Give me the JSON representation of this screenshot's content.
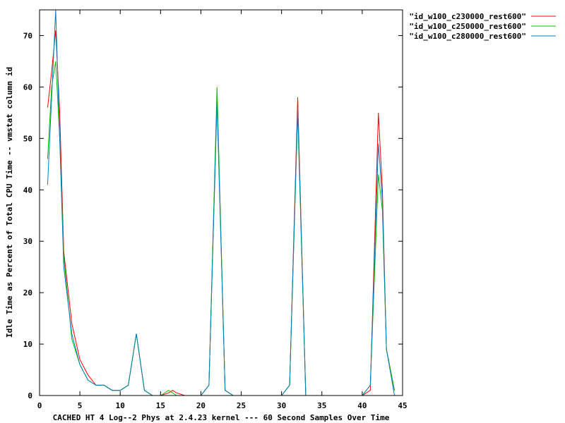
{
  "chart_data": {
    "type": "line",
    "xlabel": "CACHED HT 4 Log--2 Phys at 2.4.23 kernel --- 60 Second Samples Over Time",
    "ylabel": "Idle Time as Percent of Total CPU Time -- vmstat column id",
    "xlim": [
      0,
      45
    ],
    "ylim": [
      0,
      75
    ],
    "xticks": [
      0,
      5,
      10,
      15,
      20,
      25,
      30,
      35,
      40,
      45
    ],
    "yticks": [
      0,
      10,
      20,
      30,
      40,
      50,
      60,
      70
    ],
    "grid": false,
    "legend_position": "top-right",
    "series": [
      {
        "name": "\"id_w100_c230000_rest600\"",
        "color": "#ff0000",
        "points": [
          [
            1,
            56
          ],
          [
            1.5,
            63
          ],
          [
            2,
            71
          ],
          [
            2.5,
            55
          ],
          [
            3,
            28
          ],
          [
            4,
            14
          ],
          [
            5,
            7
          ],
          [
            6,
            4
          ],
          [
            7,
            2
          ],
          [
            8,
            2
          ],
          [
            9,
            1
          ],
          [
            10,
            1
          ],
          [
            11,
            2
          ],
          [
            12,
            12
          ],
          [
            13,
            1
          ],
          [
            14,
            0
          ],
          [
            15,
            0
          ],
          [
            16,
            0.5
          ],
          [
            16.5,
            1
          ],
          [
            17,
            0.5
          ],
          [
            18,
            0
          ],
          [
            19,
            0
          ],
          [
            20,
            0
          ],
          [
            21,
            2
          ],
          [
            22,
            58
          ],
          [
            23,
            1
          ],
          [
            24,
            0
          ],
          [
            25,
            0
          ],
          [
            26,
            0
          ],
          [
            27,
            0
          ],
          [
            28,
            0
          ],
          [
            29,
            0
          ],
          [
            30,
            0
          ],
          [
            31,
            2
          ],
          [
            32,
            58
          ],
          [
            33,
            0
          ],
          [
            34,
            0
          ],
          [
            35,
            0
          ],
          [
            36,
            0
          ],
          [
            37,
            0
          ],
          [
            38,
            0
          ],
          [
            39,
            0
          ],
          [
            40,
            0
          ],
          [
            41,
            1
          ],
          [
            42,
            55
          ],
          [
            42.5,
            40
          ],
          [
            43,
            9
          ],
          [
            44,
            1
          ]
        ]
      },
      {
        "name": "\"id_w100_c250000_rest600\"",
        "color": "#00c000",
        "points": [
          [
            1,
            46
          ],
          [
            1.5,
            60
          ],
          [
            2,
            65
          ],
          [
            2.5,
            50
          ],
          [
            3,
            27
          ],
          [
            4,
            11
          ],
          [
            5,
            6
          ],
          [
            6,
            3
          ],
          [
            7,
            2
          ],
          [
            8,
            2
          ],
          [
            9,
            1
          ],
          [
            10,
            1
          ],
          [
            11,
            2
          ],
          [
            12,
            12
          ],
          [
            13,
            1
          ],
          [
            14,
            0
          ],
          [
            15,
            0
          ],
          [
            16,
            1
          ],
          [
            17,
            0
          ],
          [
            18,
            0
          ],
          [
            19,
            0
          ],
          [
            20,
            0
          ],
          [
            21,
            2
          ],
          [
            22,
            60
          ],
          [
            23,
            1
          ],
          [
            24,
            0
          ],
          [
            25,
            0
          ],
          [
            26,
            0
          ],
          [
            27,
            0
          ],
          [
            28,
            0
          ],
          [
            29,
            0
          ],
          [
            30,
            0
          ],
          [
            31,
            2
          ],
          [
            32,
            55
          ],
          [
            33,
            0
          ],
          [
            34,
            0
          ],
          [
            35,
            0
          ],
          [
            36,
            0
          ],
          [
            37,
            0
          ],
          [
            38,
            0
          ],
          [
            39,
            0
          ],
          [
            40,
            0
          ],
          [
            41,
            2
          ],
          [
            42,
            43
          ],
          [
            42.5,
            36
          ],
          [
            43,
            9
          ],
          [
            44,
            1
          ]
        ]
      },
      {
        "name": "\"id_w100_c280000_rest600\"",
        "color": "#0080c0",
        "points": [
          [
            1,
            41
          ],
          [
            1.5,
            58
          ],
          [
            2,
            75
          ],
          [
            2.5,
            50
          ],
          [
            3,
            25
          ],
          [
            4,
            12
          ],
          [
            5,
            6
          ],
          [
            6,
            3
          ],
          [
            7,
            2
          ],
          [
            8,
            2
          ],
          [
            9,
            1
          ],
          [
            10,
            1
          ],
          [
            11,
            2
          ],
          [
            12,
            12
          ],
          [
            13,
            1
          ],
          [
            14,
            0
          ],
          [
            15,
            0
          ],
          [
            16,
            0
          ],
          [
            17,
            0
          ],
          [
            18,
            0
          ],
          [
            19,
            0
          ],
          [
            20,
            0
          ],
          [
            21,
            2
          ],
          [
            22,
            57
          ],
          [
            23,
            1
          ],
          [
            24,
            0
          ],
          [
            25,
            0
          ],
          [
            26,
            0
          ],
          [
            27,
            0
          ],
          [
            28,
            0
          ],
          [
            29,
            0
          ],
          [
            30,
            0
          ],
          [
            31,
            2
          ],
          [
            32,
            56
          ],
          [
            33,
            0
          ],
          [
            34,
            0
          ],
          [
            35,
            0
          ],
          [
            36,
            0
          ],
          [
            37,
            0
          ],
          [
            38,
            0
          ],
          [
            39,
            0
          ],
          [
            40,
            0
          ],
          [
            41,
            2
          ],
          [
            42,
            49
          ],
          [
            42.5,
            38
          ],
          [
            43,
            9
          ],
          [
            44,
            0
          ]
        ]
      }
    ]
  }
}
